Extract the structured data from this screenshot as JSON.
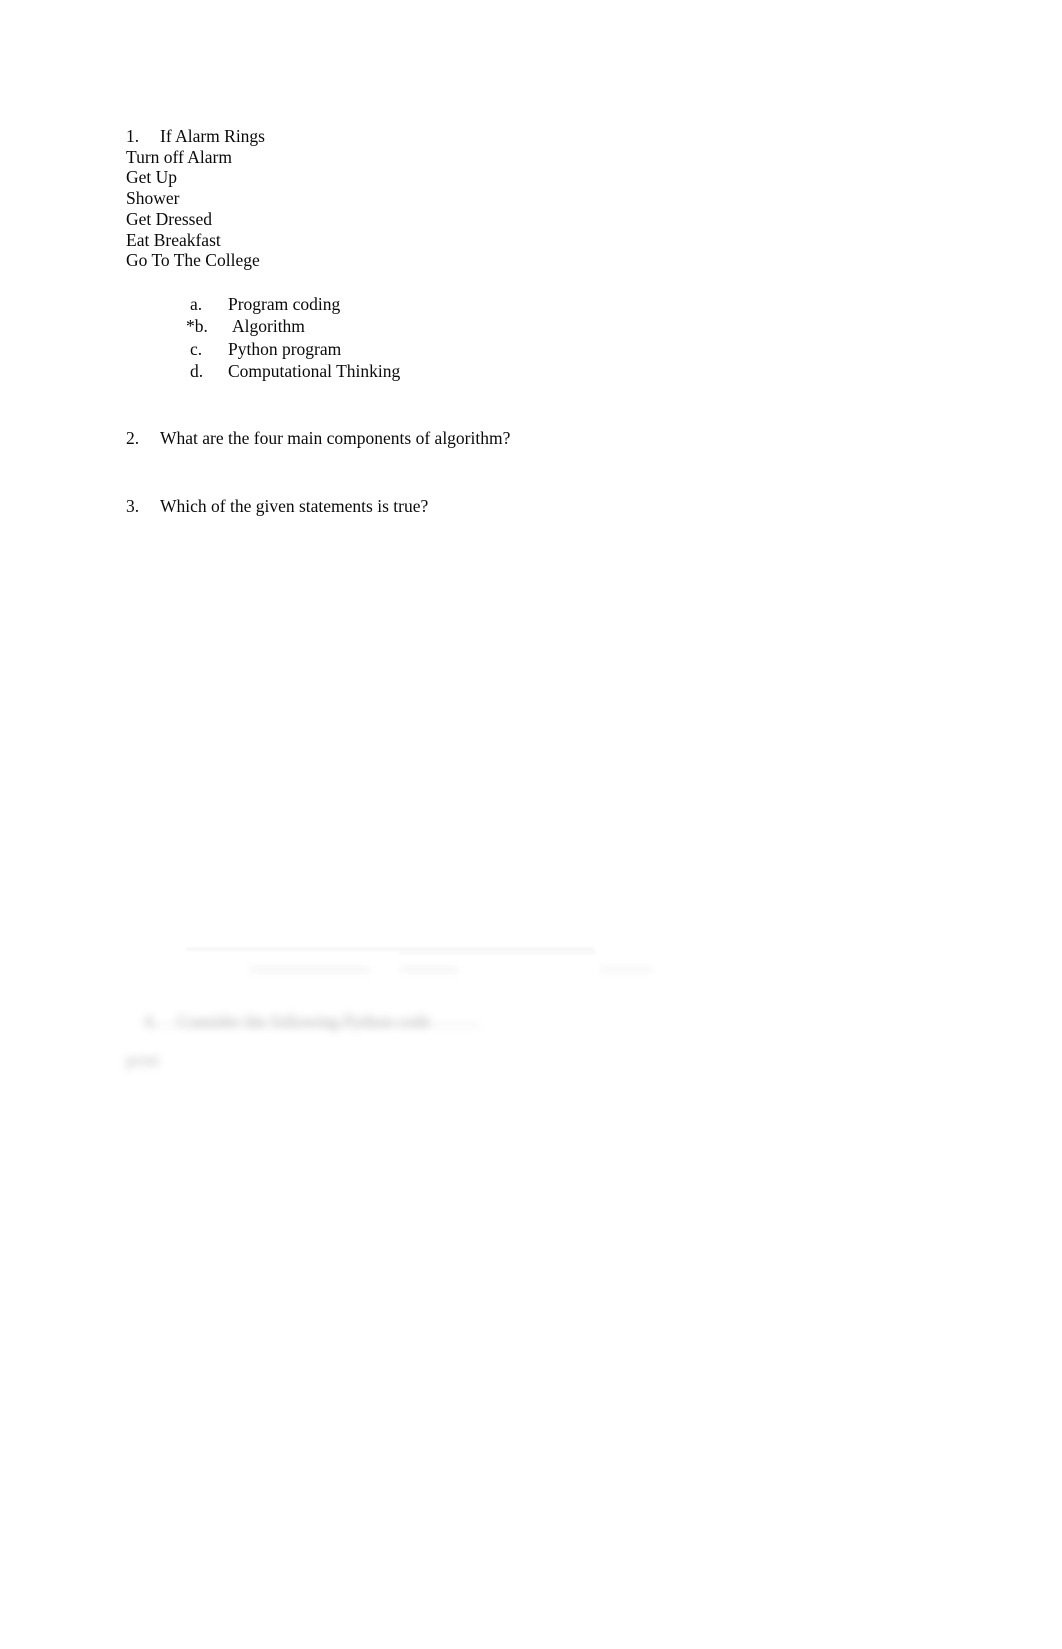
{
  "document": {
    "questions": [
      {
        "number": "1.",
        "title": "If Alarm Rings",
        "steps": [
          "Turn off Alarm",
          "Get Up",
          "Shower",
          "Get Dressed",
          "Eat Breakfast",
          "Go To The College"
        ],
        "options": [
          {
            "marker": "a.",
            "label": "Program coding",
            "correct": false
          },
          {
            "marker": "*b.",
            "label": "Algorithm",
            "correct": true
          },
          {
            "marker": "c.",
            "label": "Python program",
            "correct": false
          },
          {
            "marker": "d.",
            "label": "Computational Thinking",
            "correct": false
          }
        ]
      },
      {
        "number": "2.",
        "title": "What are the four main components of algorithm?"
      },
      {
        "number": "3.",
        "title": "Which of the given statements is true?"
      }
    ],
    "obscured": {
      "question_number": "4.",
      "question_text": "Consider the following Python code",
      "code_snippet": "print"
    }
  }
}
